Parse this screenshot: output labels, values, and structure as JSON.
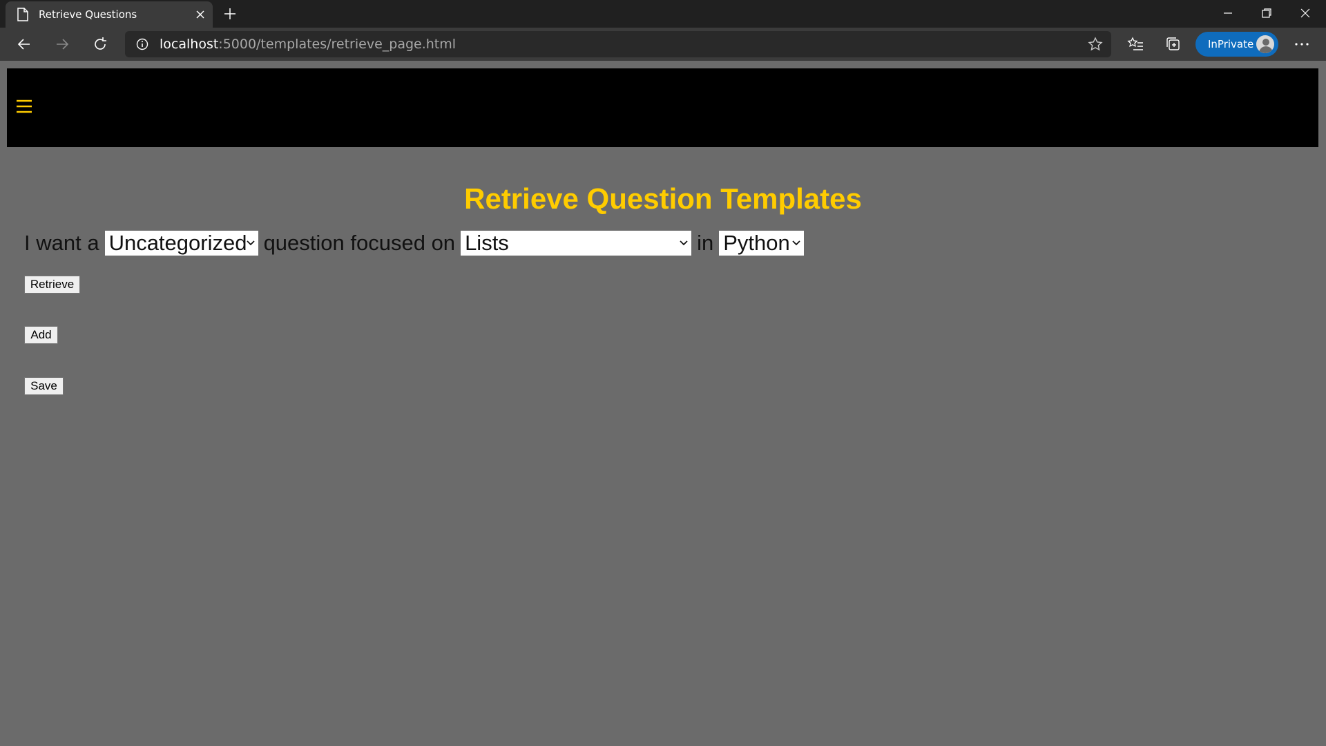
{
  "browser": {
    "tab_title": "Retrieve Questions",
    "url_host": "localhost",
    "url_rest": ":5000/templates/retrieve_page.html",
    "inprivate_label": "InPrivate",
    "icons": [
      "page-icon",
      "close-icon",
      "plus-icon",
      "minimize-icon",
      "restore-icon",
      "window-close-icon",
      "back-icon",
      "forward-icon",
      "refresh-icon",
      "info-icon",
      "star-icon",
      "favorites-icon",
      "collections-icon",
      "more-icon"
    ]
  },
  "page": {
    "navbar_color": "#000000",
    "background_color": "#6b6b6b",
    "accent_color": "#ffcc00",
    "heading": "Retrieve Question Templates",
    "query": {
      "prefix": "I want a",
      "category_selected": "Uncategorized",
      "middle": "question focused on",
      "topic_selected": "Lists",
      "connector": "in",
      "language_selected": "Python"
    },
    "buttons": {
      "retrieve": "Retrieve",
      "add": "Add",
      "save": "Save"
    }
  }
}
